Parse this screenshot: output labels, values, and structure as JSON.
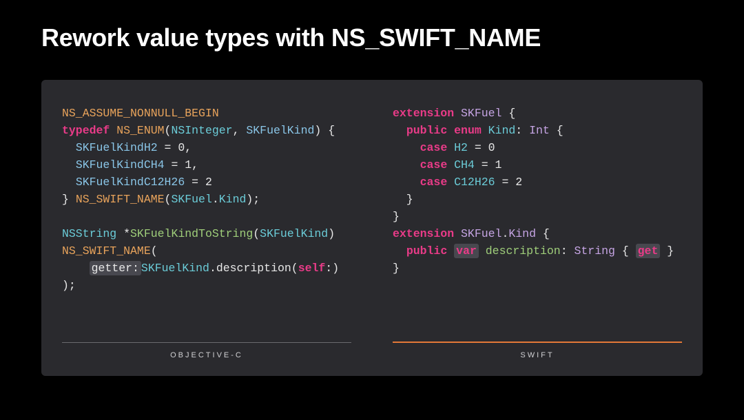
{
  "title": "Rework value types with NS_SWIFT_NAME",
  "left": {
    "label": "OBJECTIVE-C",
    "tokens": [
      [
        [
          "o",
          "NS_ASSUME_NONNULL_BEGIN"
        ]
      ],
      [
        [
          "kw",
          "typedef"
        ],
        [
          "",
          " "
        ],
        [
          "o",
          "NS_ENUM"
        ],
        [
          "",
          "("
        ],
        [
          "cy",
          "NSInteger"
        ],
        [
          "",
          ", "
        ],
        [
          "lb",
          "SKFuelKind"
        ],
        [
          "",
          ") {"
        ]
      ],
      [
        [
          "",
          "  "
        ],
        [
          "lb",
          "SKFuelKindH2"
        ],
        [
          "",
          ""
        ],
        [
          "",
          " = 0,"
        ]
      ],
      [
        [
          "",
          "  "
        ],
        [
          "lb",
          "SKFuelKindCH4"
        ],
        [
          "",
          " = 1,"
        ]
      ],
      [
        [
          "",
          "  "
        ],
        [
          "lb",
          "SKFuelKindC12H26"
        ],
        [
          "",
          " = 2"
        ]
      ],
      [
        [
          "",
          "} "
        ],
        [
          "o",
          "NS_SWIFT_NAME"
        ],
        [
          "",
          "("
        ],
        [
          "cy",
          "SKFuel"
        ],
        [
          "",
          "."
        ],
        [
          "cy",
          "Kind"
        ],
        [
          "",
          ");"
        ]
      ],
      [
        [
          "",
          ""
        ]
      ],
      [
        [
          "cy",
          "NSString"
        ],
        [
          "",
          " *"
        ],
        [
          "gr",
          "SKFuelKindToString"
        ],
        [
          "",
          "("
        ],
        [
          "cy",
          "SKFuelKind"
        ],
        [
          "",
          ")"
        ]
      ],
      [
        [
          "o",
          "NS_SWIFT_NAME"
        ],
        [
          "",
          "("
        ]
      ],
      [
        [
          "",
          "    "
        ],
        [
          "hlbox",
          "getter:"
        ],
        [
          "cy",
          "SKFuelKind"
        ],
        [
          "",
          ".description("
        ],
        [
          "kw",
          "self"
        ],
        [
          "",
          ":)"
        ]
      ],
      [
        [
          "",
          ");"
        ]
      ]
    ]
  },
  "right": {
    "label": "SWIFT",
    "tokens": [
      [
        [
          "kw",
          "extension"
        ],
        [
          "",
          " "
        ],
        [
          "pu",
          "SKFuel"
        ],
        [
          "",
          " {"
        ]
      ],
      [
        [
          "",
          "  "
        ],
        [
          "kw",
          "public"
        ],
        [
          "",
          " "
        ],
        [
          "kw",
          "enum"
        ],
        [
          "",
          " "
        ],
        [
          "cy",
          "Kind"
        ],
        [
          "",
          ": "
        ],
        [
          "pu",
          "Int"
        ],
        [
          "",
          " {"
        ]
      ],
      [
        [
          "",
          "    "
        ],
        [
          "kw",
          "case"
        ],
        [
          "",
          " "
        ],
        [
          "cy",
          "H2"
        ],
        [
          "",
          " = 0"
        ]
      ],
      [
        [
          "",
          "    "
        ],
        [
          "kw",
          "case"
        ],
        [
          "",
          " "
        ],
        [
          "cy",
          "CH4"
        ],
        [
          "",
          " = 1"
        ]
      ],
      [
        [
          "",
          "    "
        ],
        [
          "kw",
          "case"
        ],
        [
          "",
          " "
        ],
        [
          "cy",
          "C12H26"
        ],
        [
          "",
          " = 2"
        ]
      ],
      [
        [
          "",
          "  }"
        ]
      ],
      [
        [
          "",
          "}"
        ]
      ],
      [
        [
          "kw",
          "extension"
        ],
        [
          "",
          " "
        ],
        [
          "pu",
          "SKFuel"
        ],
        [
          "",
          "."
        ],
        [
          "pu",
          "Kind"
        ],
        [
          "",
          " {"
        ]
      ],
      [
        [
          "",
          "  "
        ],
        [
          "kw",
          "public"
        ],
        [
          "",
          " "
        ],
        [
          "hlbox-kw",
          "var"
        ],
        [
          "",
          " "
        ],
        [
          "gr",
          "description"
        ],
        [
          "",
          ": "
        ],
        [
          "pu",
          "String"
        ],
        [
          "",
          " { "
        ],
        [
          "hlbox-kw",
          "get"
        ],
        [
          "",
          " }"
        ]
      ],
      [
        [
          "",
          "}"
        ]
      ]
    ]
  }
}
